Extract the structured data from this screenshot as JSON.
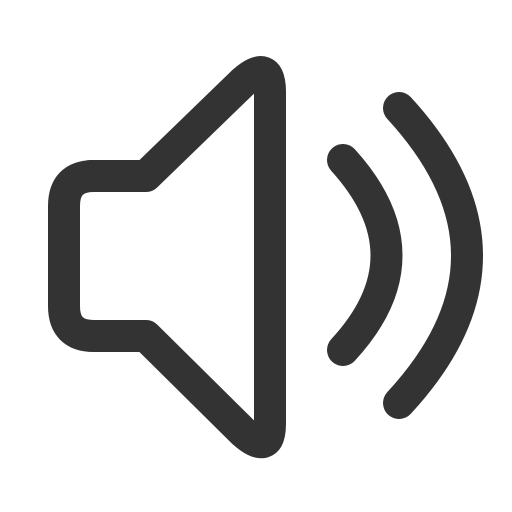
{
  "icon": {
    "name": "speaker-volume-icon",
    "stroke_color": "#333333",
    "background_color": "#ffffff"
  }
}
